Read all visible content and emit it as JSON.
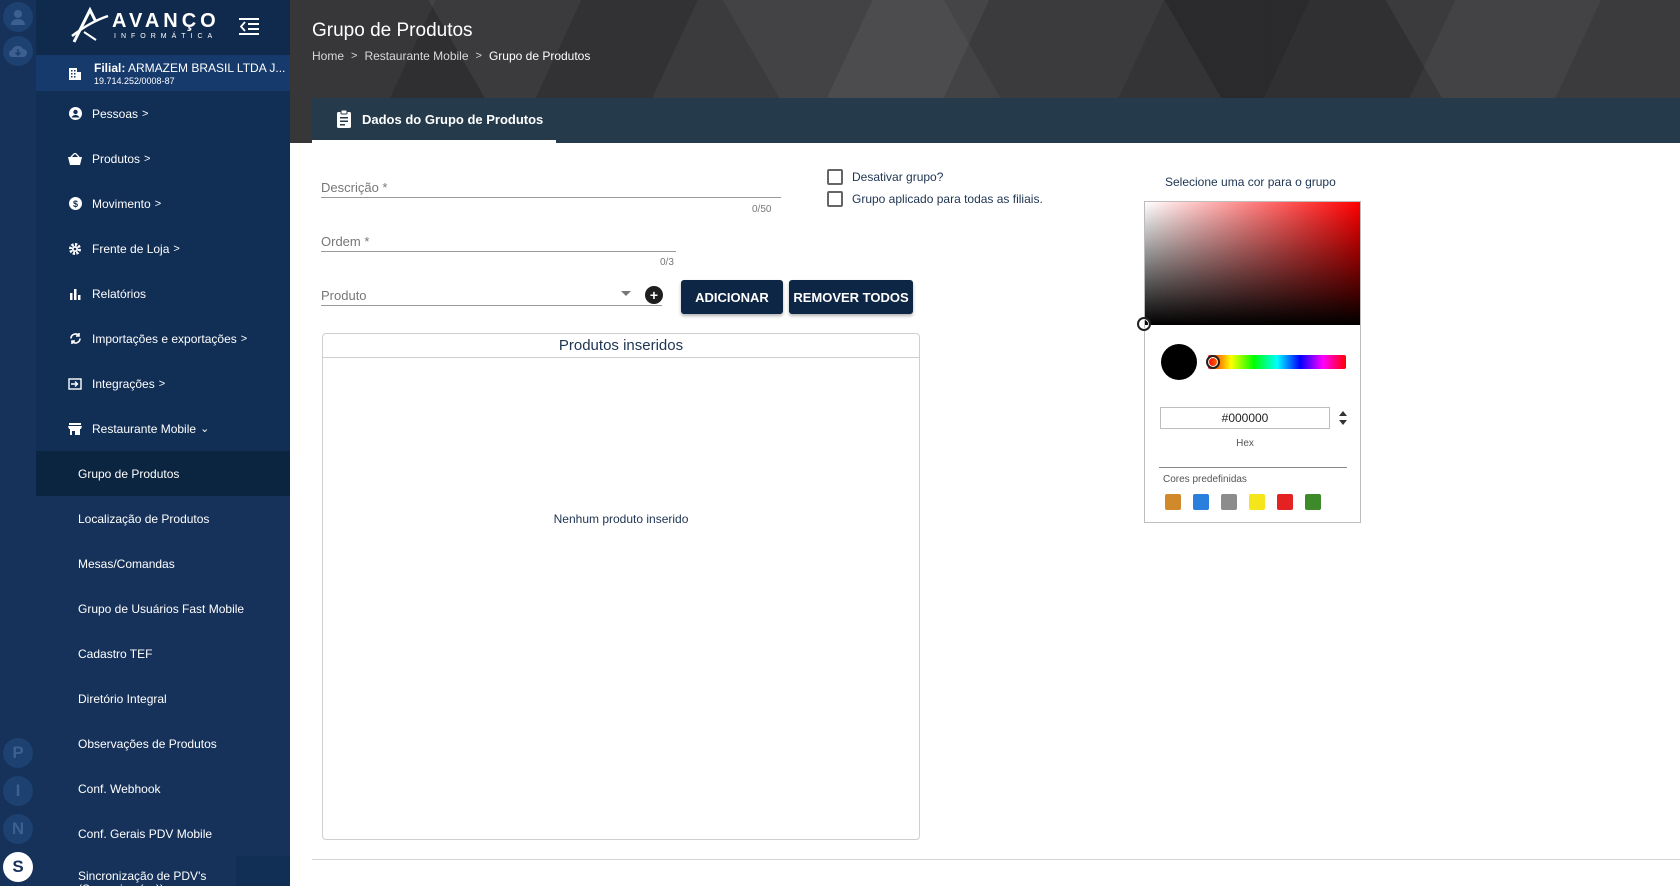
{
  "brand": {
    "name": "AVANÇO",
    "tagline": "INFORMÁTICA"
  },
  "filial": {
    "label": "Filial:",
    "name": "ARMAZEM BRASIL LTDA J...",
    "cnpj": "19.714.252/0008-87"
  },
  "rail": {
    "initials": [
      "P",
      "I",
      "N",
      "S"
    ]
  },
  "sidebar": {
    "items": [
      {
        "label": "Pessoas",
        "chev": ">"
      },
      {
        "label": "Produtos",
        "chev": ">"
      },
      {
        "label": "Movimento",
        "chev": ">"
      },
      {
        "label": "Frente de Loja",
        "chev": ">"
      },
      {
        "label": "Relatórios",
        "chev": ""
      },
      {
        "label": "Importações e exportações",
        "chev": ">"
      },
      {
        "label": "Integrações",
        "chev": ">"
      },
      {
        "label": "Restaurante Mobile",
        "chev": "⌄"
      }
    ],
    "sub_items": [
      {
        "label": "Grupo de Produtos"
      },
      {
        "label": "Localização de Produtos"
      },
      {
        "label": "Mesas/Comandas"
      },
      {
        "label": "Grupo de Usuários Fast Mobile"
      },
      {
        "label": "Cadastro TEF"
      },
      {
        "label": "Diretório Integral"
      },
      {
        "label": "Observações de Produtos"
      },
      {
        "label": "Conf. Webhook"
      },
      {
        "label": "Conf. Gerais PDV Mobile"
      },
      {
        "label": "Sincronização de PDV's (Supervisor(es))"
      }
    ]
  },
  "header": {
    "title": "Grupo de Produtos",
    "breadcrumb": [
      "Home",
      "Restaurante Mobile",
      "Grupo de Produtos"
    ]
  },
  "tab": {
    "label": "Dados do Grupo de Produtos"
  },
  "form": {
    "descricao": {
      "placeholder": "Descrição *",
      "value": "",
      "counter": "0/50"
    },
    "ordem": {
      "placeholder": "Ordem *",
      "value": "",
      "counter": "0/3"
    },
    "produto": {
      "placeholder": "Produto",
      "value": ""
    },
    "add_button": "ADICIONAR",
    "remove_all_button": "REMOVER TODOS",
    "desativar_label": "Desativar grupo?",
    "todas_filiais_label": "Grupo aplicado para todas as filiais."
  },
  "products_list": {
    "title": "Produtos inseridos",
    "empty_text": "Nenhum produto inserido"
  },
  "color_picker": {
    "label": "Selecione uma cor para o grupo",
    "hex_value": "#000000",
    "hex_label": "Hex",
    "current_color": "#000000",
    "presets_title": "Cores predefinidas",
    "presets": [
      "#d08a2c",
      "#2a7fdd",
      "#8c8c8c",
      "#f5e61b",
      "#e52222",
      "#3d8a2a"
    ]
  }
}
